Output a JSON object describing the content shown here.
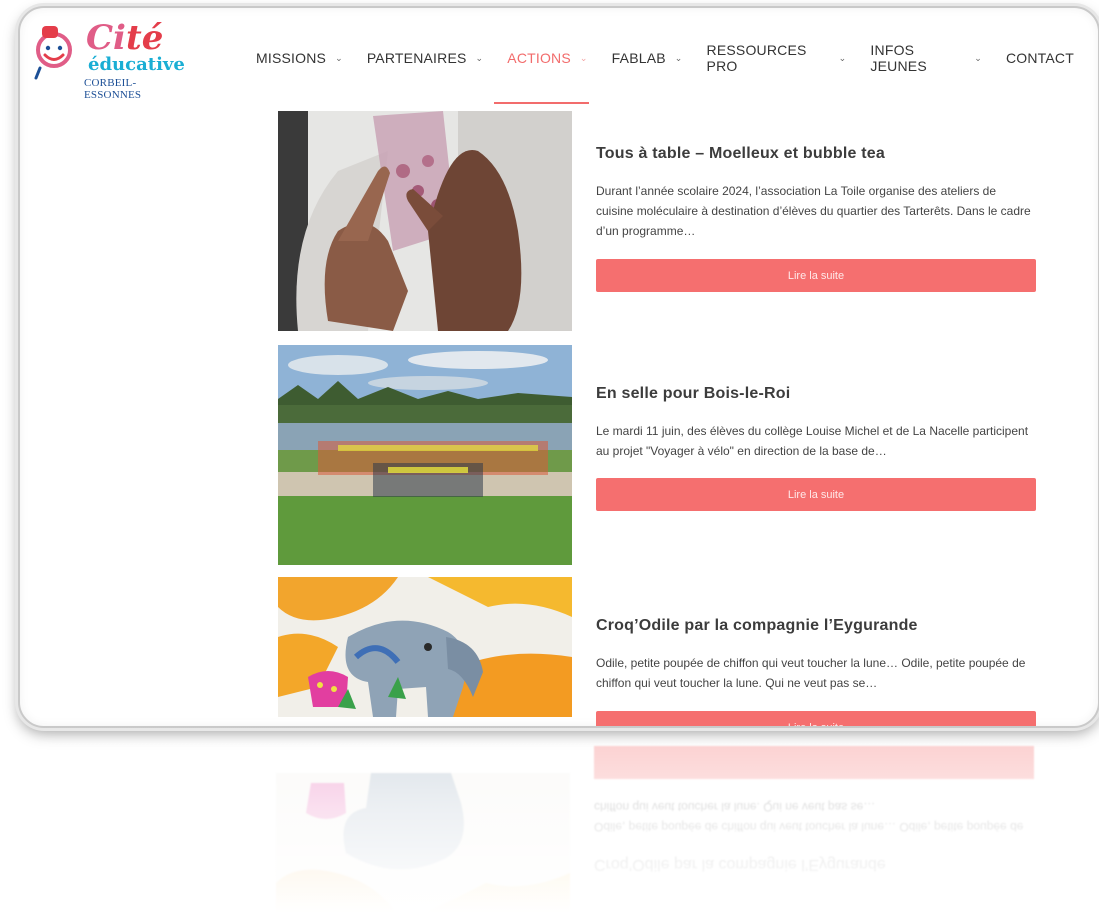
{
  "logo": {
    "cite_part1": "Ci",
    "cite_part2": "té",
    "subtitle": "éducative",
    "city": "CORBEIL-ESSONNES"
  },
  "nav": {
    "items": [
      {
        "label": "MISSIONS",
        "has_dropdown": true
      },
      {
        "label": "PARTENAIRES",
        "has_dropdown": true
      },
      {
        "label": "ACTIONS",
        "has_dropdown": true,
        "active": true
      },
      {
        "label": "FABLAB",
        "has_dropdown": true
      },
      {
        "label": "RESSOURCES PRO",
        "has_dropdown": true
      },
      {
        "label": "INFOS JEUNES",
        "has_dropdown": true
      },
      {
        "label": "CONTACT",
        "has_dropdown": false
      }
    ],
    "chevron": "⌄",
    "active_color": "#f26c6c"
  },
  "posts": [
    {
      "title": "Tous à table – Moelleux et bubble tea",
      "excerpt": "Durant l’année scolaire 2024, l’association La Toile organise des ateliers de cuisine moléculaire à destination d’élèves du quartier des Tarterêts. Dans le cadre d’un programme…",
      "button": "Lire la suite"
    },
    {
      "title": "En selle pour Bois-le-Roi",
      "excerpt": "Le mardi 11 juin, des élèves du collège Louise Michel et de La Nacelle participent au projet \"Voyager à vélo\" en direction de la base de…",
      "button": "Lire la suite"
    },
    {
      "title": "Croq’Odile par la compagnie l’Eygurande",
      "excerpt": "Odile, petite poupée de chiffon qui veut toucher la lune… Odile, petite poupée de chiffon qui veut toucher la lune. Qui ne veut pas se…",
      "button": "Lire la suite"
    }
  ],
  "colors": {
    "accent": "#f56f6f",
    "logo_pink": "#e05d87",
    "logo_red": "#e43d4a",
    "logo_cyan": "#1aaed4",
    "logo_navy": "#1c4f96"
  }
}
